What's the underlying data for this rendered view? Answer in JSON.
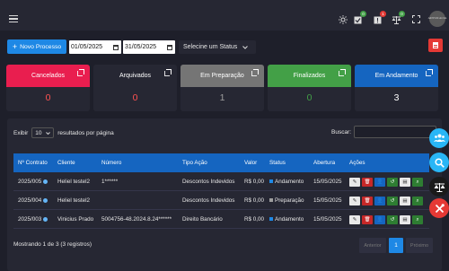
{
  "topbar": {
    "icons": [
      "menu-icon",
      "brightness-icon",
      "clipboard-check-icon",
      "clipboard-alert-icon",
      "scale-icon",
      "fullscreen-icon"
    ],
    "badges": {
      "approved": "0",
      "alert": "1",
      "scale": "0"
    },
    "logo_text": "ADVOCACIA"
  },
  "toolbar": {
    "new_button": "Novo Processo",
    "date_from": "01/05/2025",
    "date_to": "31/05/2025",
    "status_select": "Selecine um Status"
  },
  "cards": [
    {
      "label": "Cancelados",
      "value": "0",
      "color": "#e91e4f",
      "value_color": "#ff5252"
    },
    {
      "label": "Arquivados",
      "value": "0",
      "color": "#262733",
      "value_color": "#ff5252"
    },
    {
      "label": "Em Preparação",
      "value": "1",
      "color": "#757575",
      "value_color": "#9e9e9e"
    },
    {
      "label": "Finalizados",
      "value": "0",
      "color": "#43a047",
      "value_color": "#43a047"
    },
    {
      "label": "Em Andamento",
      "value": "3",
      "color": "#1565c0",
      "value_color": "#ffffff"
    }
  ],
  "table": {
    "show_label": "Exibir",
    "page_size": "10",
    "per_page_label": "resultados por página",
    "search_label": "Buscar:",
    "headers": [
      "Nº Contrato",
      "Cliente",
      "Número",
      "Tipo Ação",
      "Valor",
      "Status",
      "Abertura",
      "Ações"
    ],
    "rows": [
      {
        "contrato": "2025/005",
        "cliente": "Heliel testel2",
        "numero": "1******",
        "tipo": "Descontos Indevidos",
        "valor": "R$ 0,00",
        "status": "Andamento",
        "status_color": "#1e88e5",
        "abertura": "15/05/2025"
      },
      {
        "contrato": "2025/004",
        "cliente": "Heliel testel2",
        "numero": "",
        "tipo": "Descontos Indevidos",
        "valor": "R$ 0,00",
        "status": "Preparação",
        "status_color": "#9e9e9e",
        "abertura": "15/05/2025"
      },
      {
        "contrato": "2025/003",
        "cliente": "Vinicius Prado",
        "numero": "5004756-48.2024.8.24******",
        "tipo": "Direito Bancário",
        "valor": "R$ 0,00",
        "status": "Andamento",
        "status_color": "#1e88e5",
        "abertura": "15/05/2025"
      }
    ],
    "footer": "Mostrando 1 de 3 (3 registros)",
    "pagination": {
      "prev": "Anterior",
      "current": "1",
      "next": "Próximo"
    }
  },
  "action_icons": [
    "edit-icon",
    "delete-icon",
    "user-icon",
    "history-icon",
    "document-icon",
    "search-icon"
  ],
  "floating": [
    "team-icon",
    "search-icon",
    "scale-icon",
    "tools-icon"
  ]
}
